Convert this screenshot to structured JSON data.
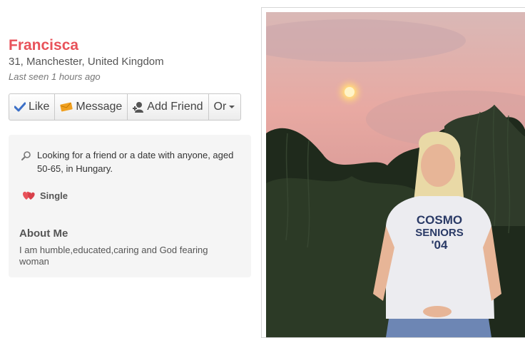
{
  "profile": {
    "name": "Francisca",
    "age_location": "31, Manchester, United Kingdom",
    "last_seen": "Last seen 1 hours ago"
  },
  "actions": {
    "like": "Like",
    "message": "Message",
    "add_friend": "Add Friend",
    "more": "Or"
  },
  "details": {
    "looking_for": "Looking for a friend or a date with anyone, aged 50-65, in Hungary.",
    "status": "Single"
  },
  "about": {
    "heading": "About Me",
    "text": "I am humble,educated,caring and God fearing woman"
  },
  "photo": {
    "shirt_line1": "COSMO",
    "shirt_line2": "SENIORS",
    "shirt_line3": "'04"
  },
  "colors": {
    "name": "#e8525a",
    "like_icon": "#3b6fc7",
    "message_icon": "#f0a020",
    "heart": "#e8525a"
  },
  "icons": {
    "like": "check-icon",
    "message": "envelope-icon",
    "add_friend": "person-plus-icon",
    "more": "caret-down-icon",
    "looking": "search-icon",
    "status": "hearts-icon"
  }
}
